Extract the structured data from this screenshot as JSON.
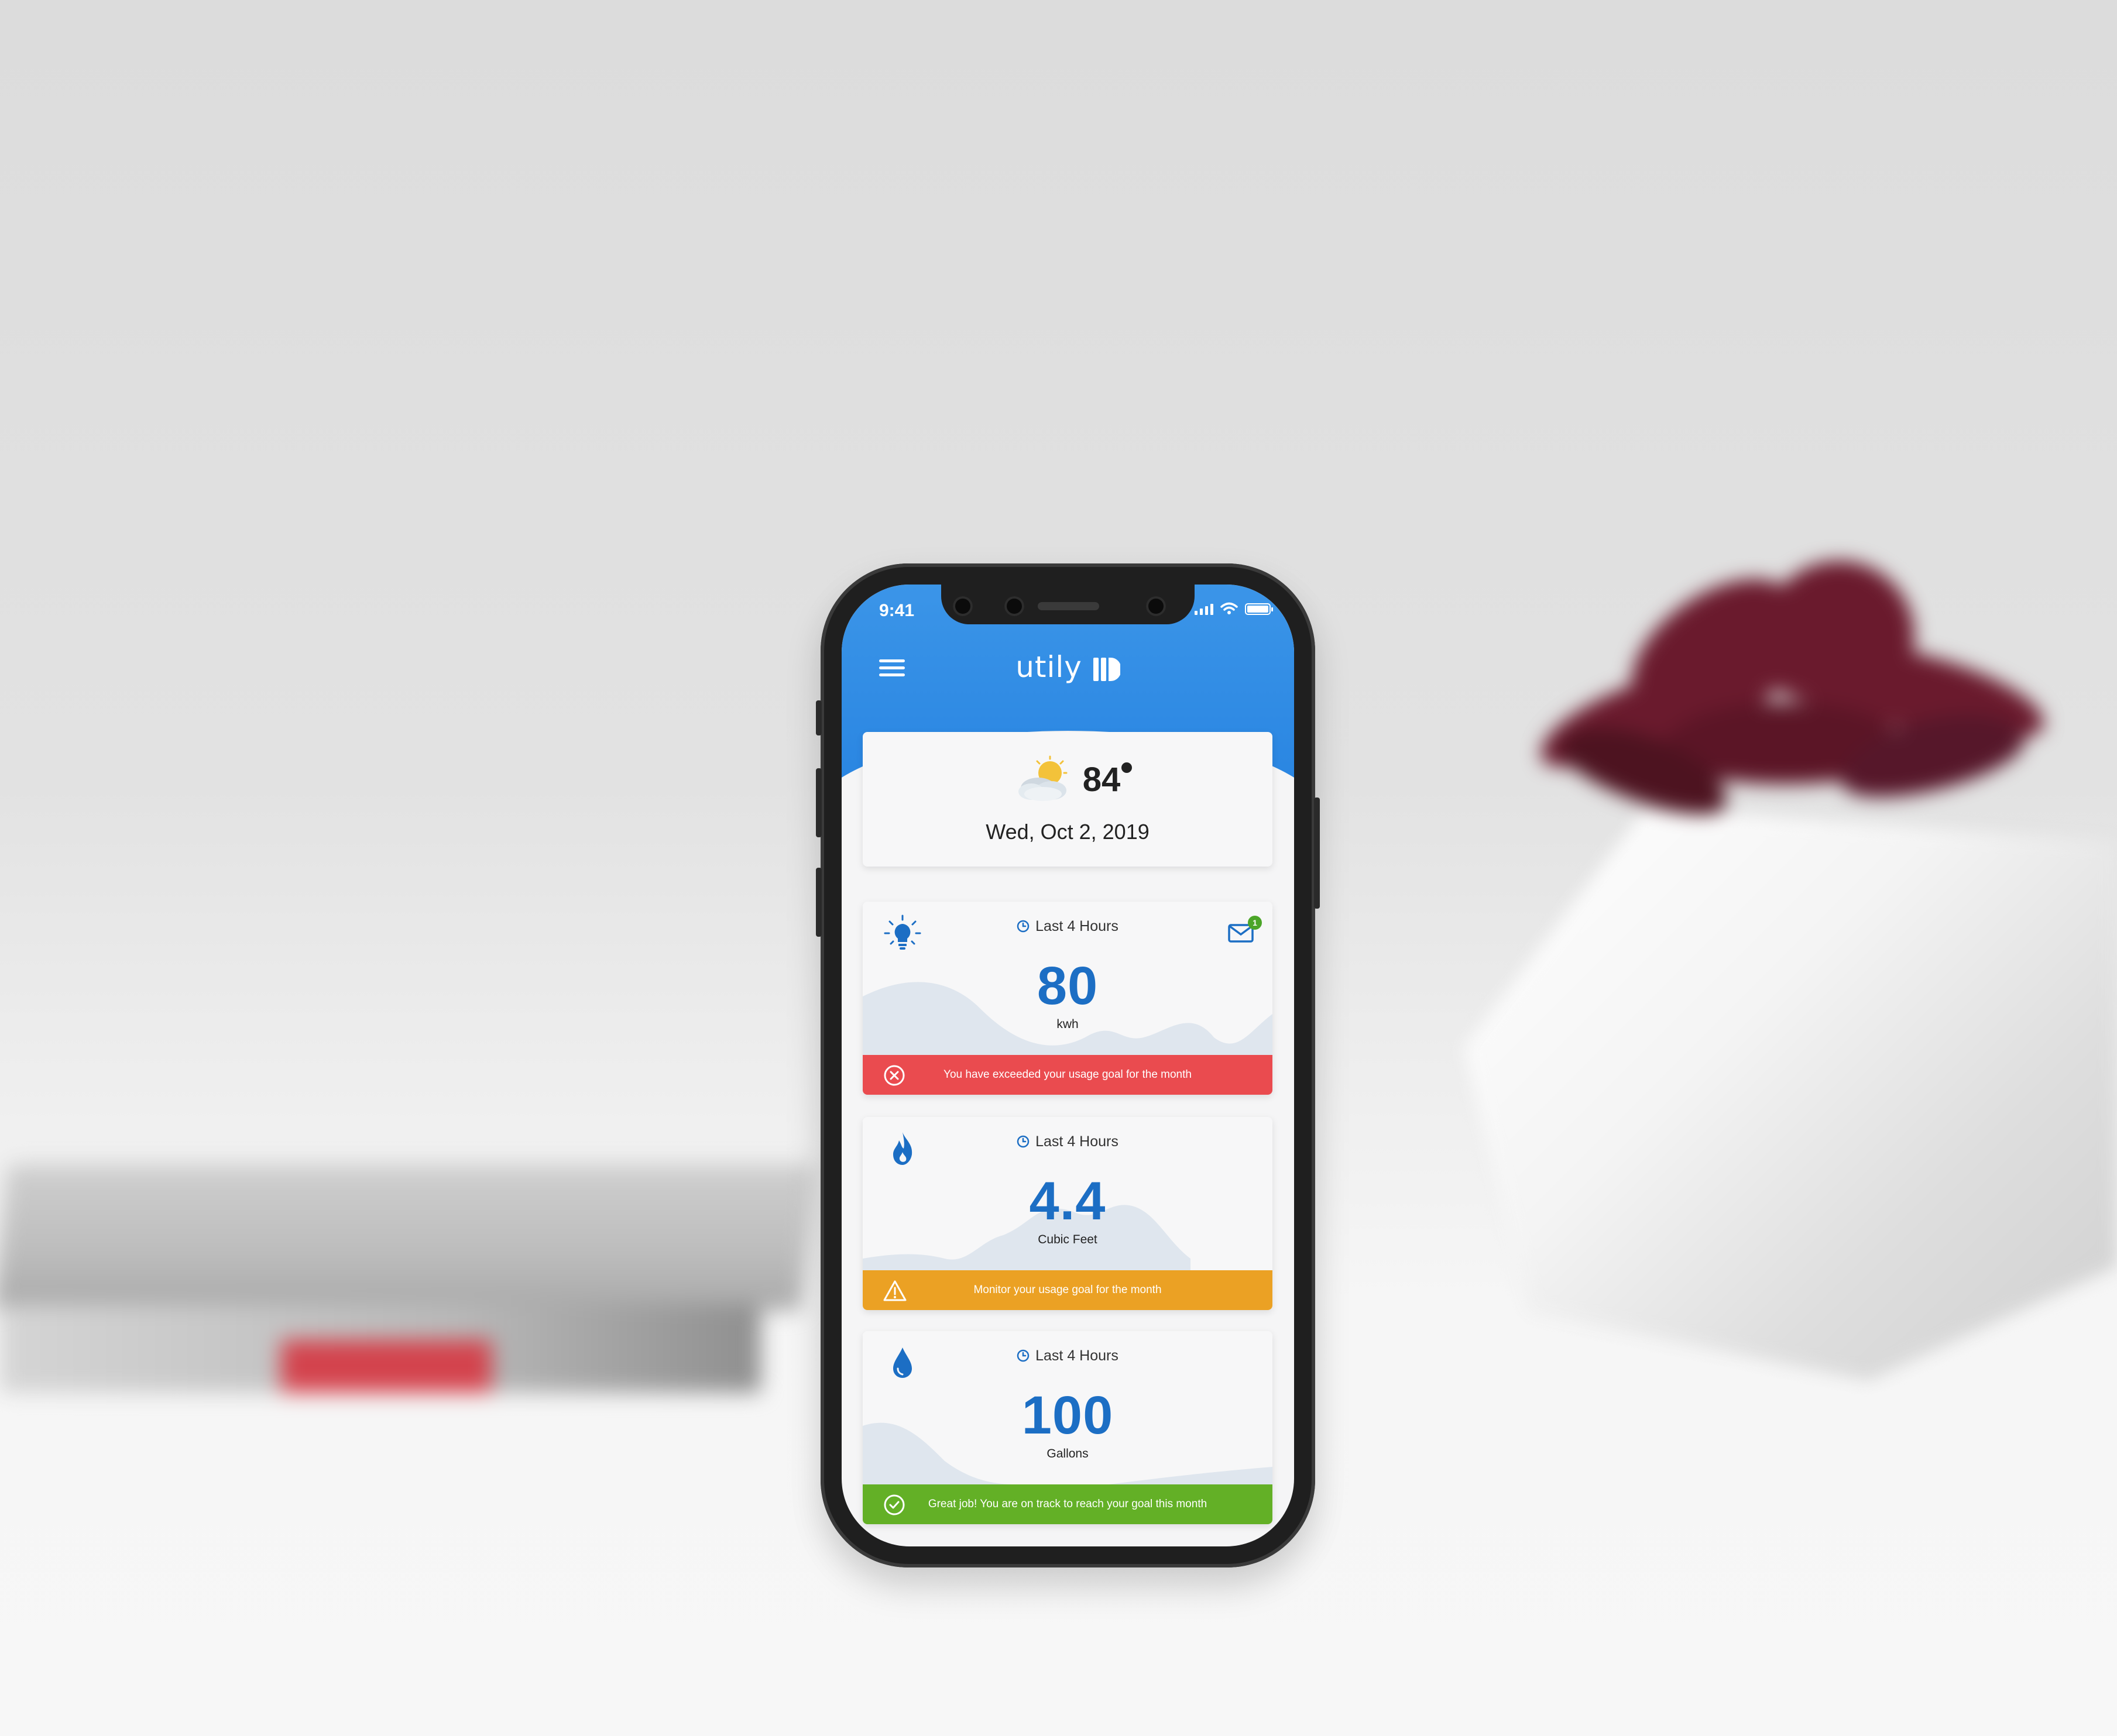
{
  "status_bar": {
    "time": "9:41"
  },
  "header": {
    "app_name": "utily",
    "menu_icon": "hamburger-menu-icon",
    "logo_icon": "utily-logo-mark"
  },
  "weather": {
    "temperature": "84",
    "condition_icon": "partly-cloudy-icon",
    "date": "Wed, Oct 2, 2019"
  },
  "cards": [
    {
      "type_icon": "lightbulb-icon",
      "period": "Last 4 Hours",
      "value": "80",
      "unit": "kwh",
      "messages_badge": "1",
      "alert": {
        "level": "error",
        "icon": "error-circle-icon",
        "text": "You have exceeded your usage goal for the month",
        "color": "#ea4b4f"
      }
    },
    {
      "type_icon": "flame-icon",
      "period": "Last 4 Hours",
      "value": "4.4",
      "unit": "Cubic Feet",
      "alert": {
        "level": "warning",
        "icon": "warning-triangle-icon",
        "text": "Monitor your usage goal for the month",
        "color": "#eba124"
      }
    },
    {
      "type_icon": "water-drop-icon",
      "period": "Last 4 Hours",
      "value": "100",
      "unit": "Gallons",
      "alert": {
        "level": "success",
        "icon": "check-circle-icon",
        "text": "Great job! You are on track to reach your goal this month",
        "color": "#63b026"
      }
    }
  ],
  "colors": {
    "header_blue": "#2a86e2",
    "value_blue": "#1c6ec4",
    "background": "#f5f5f6"
  }
}
